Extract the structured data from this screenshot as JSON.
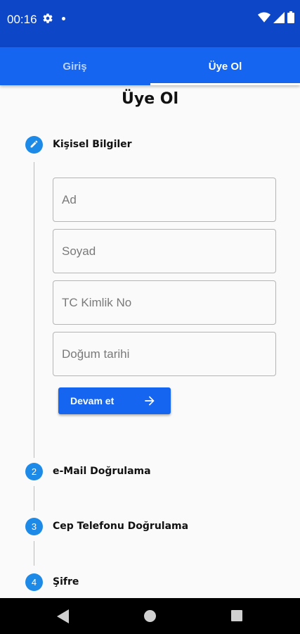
{
  "status_bar": {
    "time": "00:16"
  },
  "tabs": [
    {
      "label": "Giriş",
      "active": false
    },
    {
      "label": "Üye Ol",
      "active": true
    }
  ],
  "page": {
    "title": "Üye Ol"
  },
  "steps": [
    {
      "number": "",
      "icon": "pencil-icon",
      "title": "Kişisel Bilgiler",
      "active": true
    },
    {
      "number": "2",
      "title": "e-Mail Doğrulama"
    },
    {
      "number": "3",
      "title": "Cep Telefonu Doğrulama"
    },
    {
      "number": "4",
      "title": "Şifre"
    }
  ],
  "form": {
    "first_name": {
      "placeholder": "Ad",
      "value": ""
    },
    "last_name": {
      "placeholder": "Soyad",
      "value": ""
    },
    "tc_no": {
      "placeholder": "TC Kimlik No",
      "value": ""
    },
    "birth_date": {
      "placeholder": "Doğum tarihi",
      "value": ""
    },
    "continue_label": "Devam et"
  },
  "colors": {
    "status_bar": "#0d47c7",
    "tab_bar": "#1565f0",
    "step_circle": "#1e8ae8",
    "button": "#1565f0"
  }
}
